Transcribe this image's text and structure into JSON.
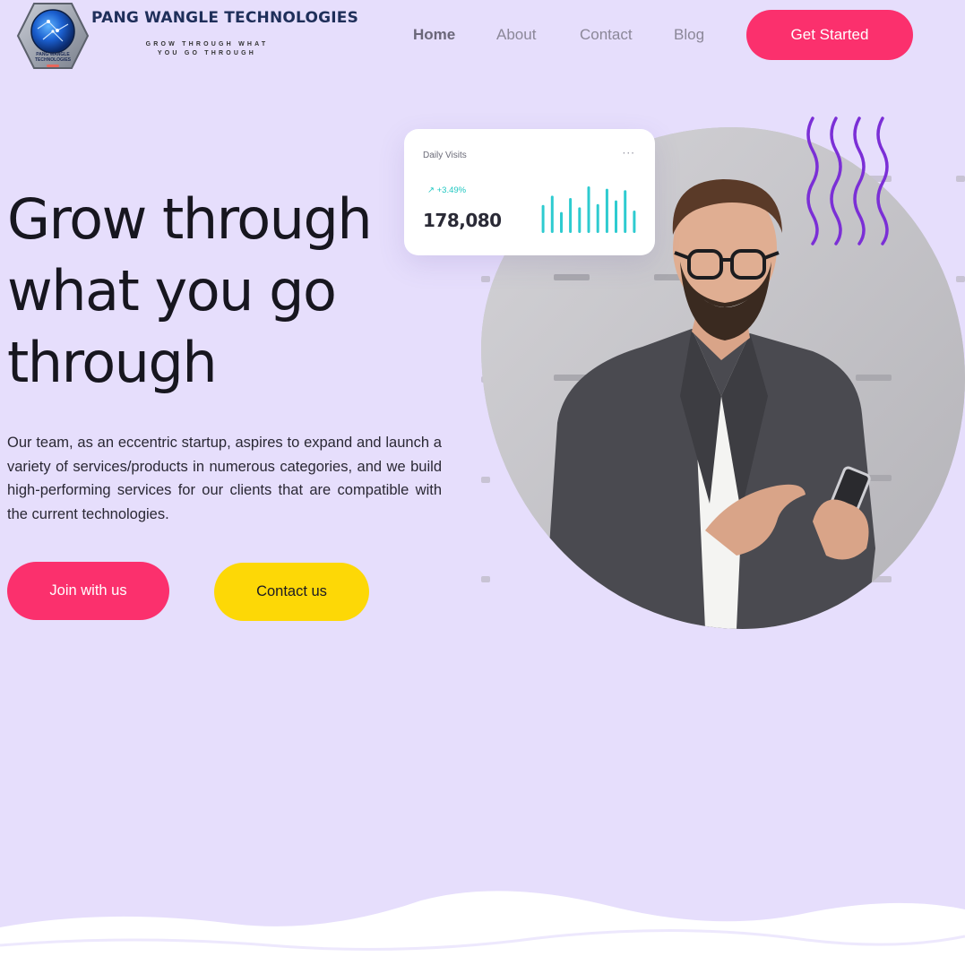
{
  "header": {
    "brand_name": "PANG WANGLE TECHNOLOGIES",
    "brand_tagline_line1": "GROW THROUGH WHAT",
    "brand_tagline_line2": "YOU GO THROUGH",
    "logo_text_line1": "PANG WANGLE",
    "logo_text_line2": "TECHNOLOGIES",
    "nav": [
      {
        "label": "Home",
        "active": true
      },
      {
        "label": "About"
      },
      {
        "label": "Contact"
      },
      {
        "label": "Blog"
      }
    ],
    "cta_label": "Get Started"
  },
  "hero": {
    "title_line1": "Grow through",
    "title_line2": "what you go",
    "title_line3": "through",
    "description": "Our team, as an eccentric startup, aspires to expand and launch a variety of services/products in numerous categories, and we build high-performing services for our clients that are compatible with the current technologies.",
    "primary_button": "Join with us",
    "secondary_button": "Contact us"
  },
  "stats_card": {
    "title": "Daily Visits",
    "more_icon": "more-horizontal-icon",
    "trend_icon": "arrow-up-right-icon",
    "trend": "+3.49%",
    "value": "178,080",
    "bars": [
      0.6,
      0.8,
      0.45,
      0.75,
      0.55,
      1.0,
      0.62,
      0.95,
      0.7,
      0.92,
      0.48
    ]
  },
  "colors": {
    "background": "#e6defc",
    "accent_pink": "#fb306d",
    "accent_yellow": "#fdd806",
    "chart_teal": "#2ecbd0",
    "wave_purple": "#7b2fd6"
  }
}
